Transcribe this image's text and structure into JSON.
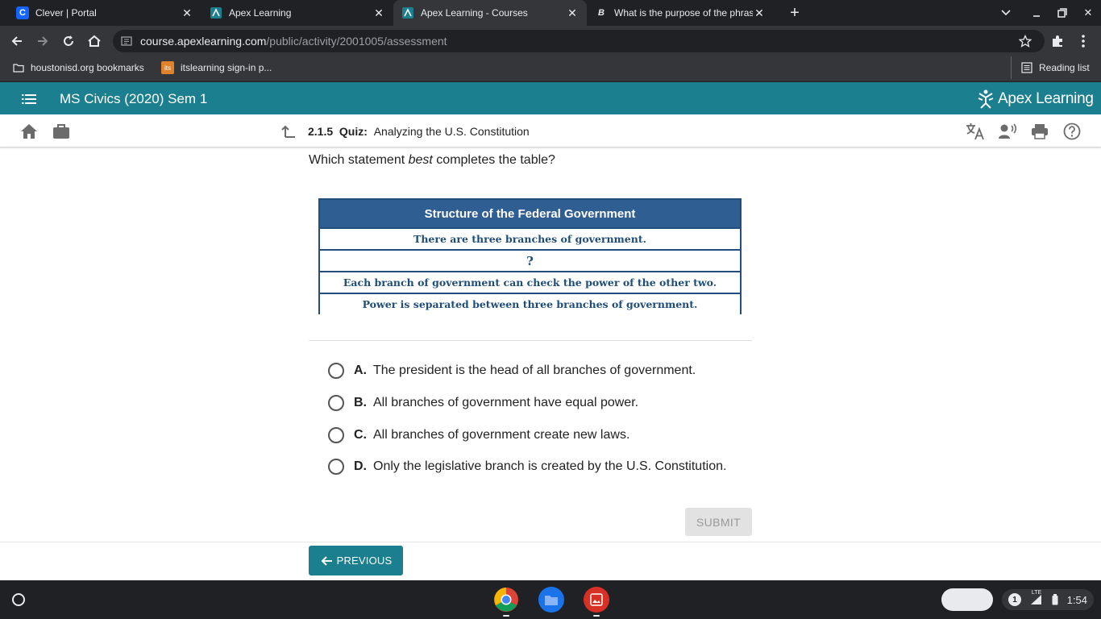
{
  "browser": {
    "tabs": [
      {
        "title": "Clever | Portal",
        "favicon": "C",
        "favicon_color": "#1464ff",
        "active": false
      },
      {
        "title": "Apex Learning",
        "favicon": "",
        "favicon_color": "#1b7f8f",
        "active": false
      },
      {
        "title": "Apex Learning - Courses",
        "favicon": "",
        "favicon_color": "#1b7f8f",
        "active": true
      },
      {
        "title": "What is the purpose of the phras",
        "favicon": "B",
        "favicon_color": "#202124",
        "active": false
      }
    ],
    "url_host": "course.apexlearning.com",
    "url_path": "/public/activity/2001005/assessment",
    "bookmarks": [
      {
        "label": "houstonisd.org bookmarks",
        "icon": "folder-icon"
      },
      {
        "label": "itslearning sign-in p...",
        "icon": "its",
        "icon_color": "#e0822b"
      }
    ],
    "reading_list": "Reading list"
  },
  "app": {
    "course_title": "MS Civics (2020) Sem 1",
    "brand": "Apex Learning",
    "accent": "#1b7f8f"
  },
  "quiz": {
    "number": "2.1.5",
    "type": "Quiz:",
    "title": "Analyzing the U.S. Constitution",
    "question_before": "Which statement ",
    "question_emph": "best",
    "question_after": " completes the table?"
  },
  "table": {
    "header": "Structure of the Federal Government",
    "rows": [
      "There are three branches of government.",
      "?",
      "Each branch of government can check the power of the other two.",
      "Power is separated between three branches of government."
    ]
  },
  "options": [
    {
      "letter": "A.",
      "text": "The president is the head of all branches of government."
    },
    {
      "letter": "B.",
      "text": "All branches of government have equal power."
    },
    {
      "letter": "C.",
      "text": "All branches of government create new laws."
    },
    {
      "letter": "D.",
      "text": "Only the legislative branch is created by the U.S. Constitution."
    }
  ],
  "buttons": {
    "submit": "SUBMIT",
    "previous": "PREVIOUS"
  },
  "system": {
    "time": "1:54",
    "network": "LTE",
    "notifications": "1"
  }
}
